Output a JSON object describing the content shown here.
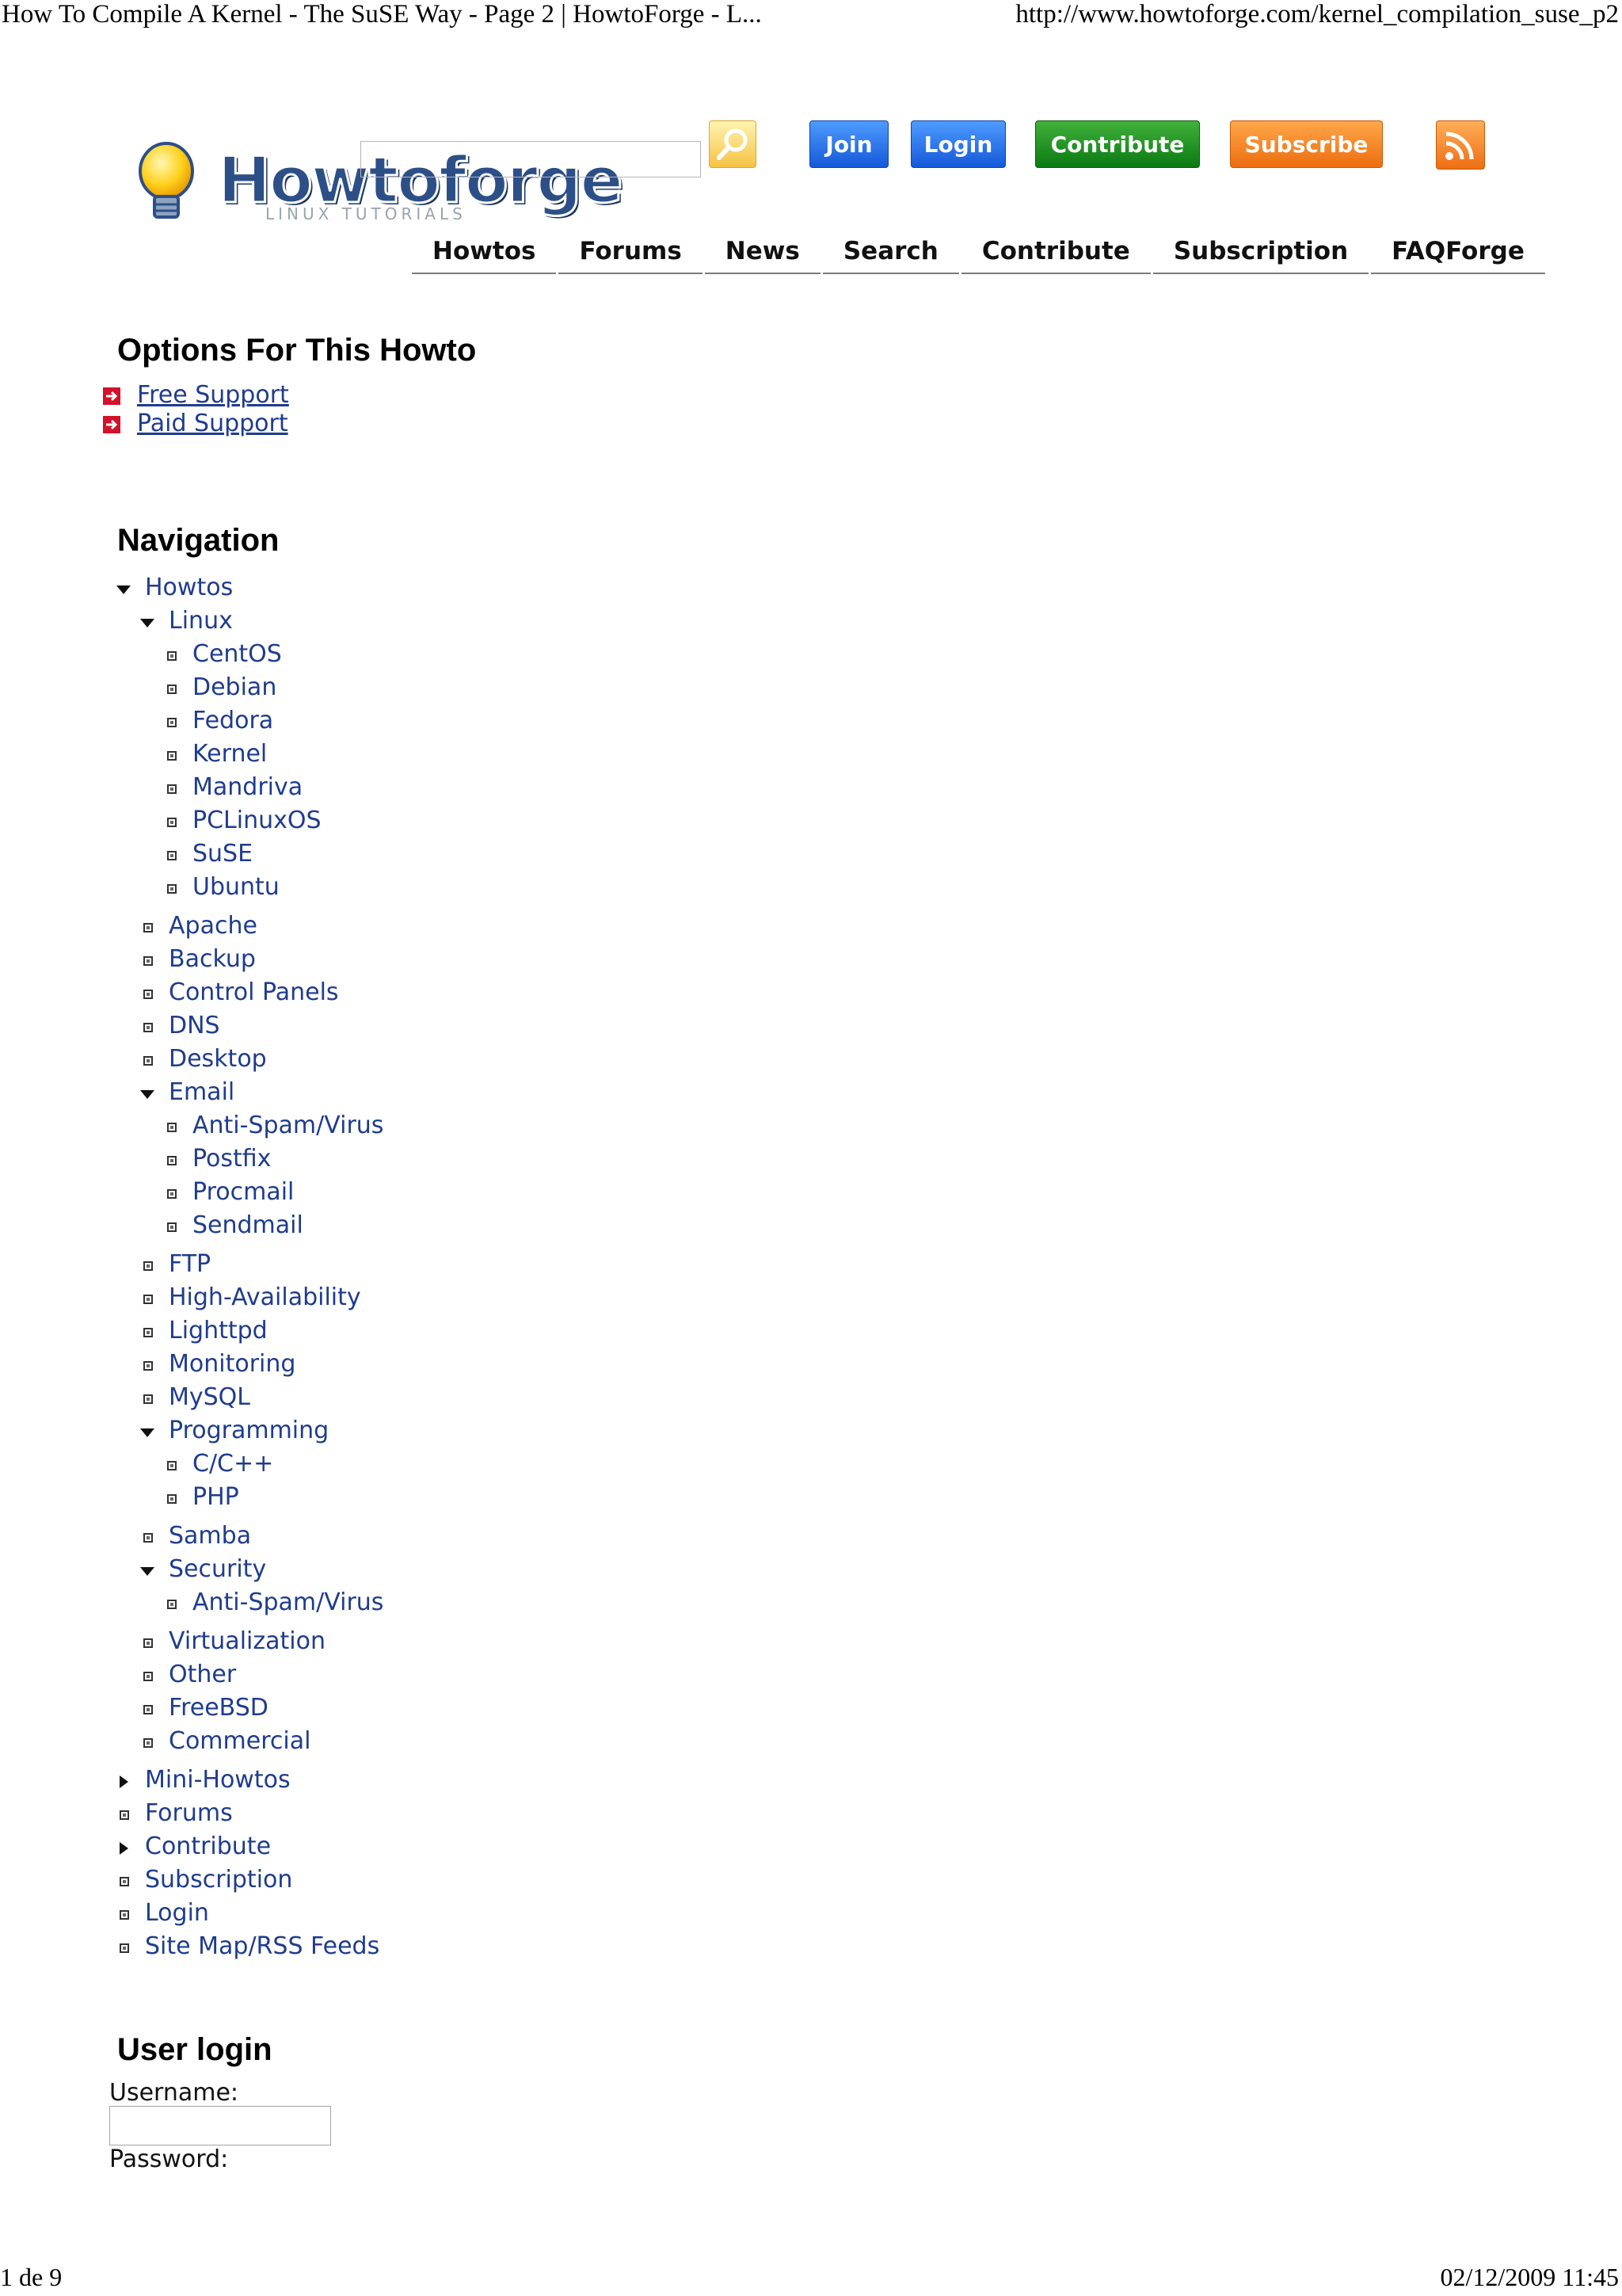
{
  "print": {
    "title": "How To Compile A Kernel - The SuSE Way - Page 2 | HowtoForge - L...",
    "url": "http://www.howtoforge.com/kernel_compilation_suse_p2",
    "page": "1 de 9",
    "datetime": "02/12/2009 11:45"
  },
  "header": {
    "logo_text": "Howtoforge",
    "logo_tagline": "LINUX TUTORIALS",
    "search": {
      "value": "",
      "placeholder": ""
    },
    "buttons": {
      "join": "Join",
      "login": "Login",
      "contribute": "Contribute",
      "subscribe": "Subscribe"
    }
  },
  "topnav": [
    "Howtos",
    "Forums",
    "News",
    "Search",
    "Contribute",
    "Subscription",
    "FAQForge"
  ],
  "options": {
    "title": "Options For This Howto",
    "links": [
      "Free Support",
      "Paid Support"
    ]
  },
  "navigation": {
    "title": "Navigation",
    "items": [
      {
        "label": "Howtos",
        "level": 0,
        "marker": "down"
      },
      {
        "label": "Linux",
        "level": 1,
        "marker": "down"
      },
      {
        "label": "CentOS",
        "level": 2,
        "marker": "bullet"
      },
      {
        "label": "Debian",
        "level": 2,
        "marker": "bullet"
      },
      {
        "label": "Fedora",
        "level": 2,
        "marker": "bullet"
      },
      {
        "label": "Kernel",
        "level": 2,
        "marker": "bullet"
      },
      {
        "label": "Mandriva",
        "level": 2,
        "marker": "bullet"
      },
      {
        "label": "PCLinuxOS",
        "level": 2,
        "marker": "bullet"
      },
      {
        "label": "SuSE",
        "level": 2,
        "marker": "bullet"
      },
      {
        "label": "Ubuntu",
        "level": 2,
        "marker": "bullet"
      },
      {
        "label": "Apache",
        "level": 1,
        "marker": "bullet",
        "gap": true
      },
      {
        "label": "Backup",
        "level": 1,
        "marker": "bullet"
      },
      {
        "label": "Control Panels",
        "level": 1,
        "marker": "bullet"
      },
      {
        "label": "DNS",
        "level": 1,
        "marker": "bullet"
      },
      {
        "label": "Desktop",
        "level": 1,
        "marker": "bullet"
      },
      {
        "label": "Email",
        "level": 1,
        "marker": "down"
      },
      {
        "label": "Anti-Spam/Virus",
        "level": 2,
        "marker": "bullet"
      },
      {
        "label": "Postfix",
        "level": 2,
        "marker": "bullet"
      },
      {
        "label": "Procmail",
        "level": 2,
        "marker": "bullet"
      },
      {
        "label": "Sendmail",
        "level": 2,
        "marker": "bullet"
      },
      {
        "label": "FTP",
        "level": 1,
        "marker": "bullet",
        "gap": true
      },
      {
        "label": "High-Availability",
        "level": 1,
        "marker": "bullet"
      },
      {
        "label": "Lighttpd",
        "level": 1,
        "marker": "bullet"
      },
      {
        "label": "Monitoring",
        "level": 1,
        "marker": "bullet"
      },
      {
        "label": "MySQL",
        "level": 1,
        "marker": "bullet"
      },
      {
        "label": "Programming",
        "level": 1,
        "marker": "down"
      },
      {
        "label": "C/C++",
        "level": 2,
        "marker": "bullet"
      },
      {
        "label": "PHP",
        "level": 2,
        "marker": "bullet"
      },
      {
        "label": "Samba",
        "level": 1,
        "marker": "bullet",
        "gap": true
      },
      {
        "label": "Security",
        "level": 1,
        "marker": "down"
      },
      {
        "label": "Anti-Spam/Virus",
        "level": 2,
        "marker": "bullet"
      },
      {
        "label": "Virtualization",
        "level": 1,
        "marker": "bullet",
        "gap": true
      },
      {
        "label": "Other",
        "level": 1,
        "marker": "bullet"
      },
      {
        "label": "FreeBSD",
        "level": 1,
        "marker": "bullet"
      },
      {
        "label": "Commercial",
        "level": 1,
        "marker": "bullet"
      },
      {
        "label": "Mini-Howtos",
        "level": 0,
        "marker": "right",
        "gap": true
      },
      {
        "label": "Forums",
        "level": 0,
        "marker": "bullet"
      },
      {
        "label": "Contribute",
        "level": 0,
        "marker": "right"
      },
      {
        "label": "Subscription",
        "level": 0,
        "marker": "bullet"
      },
      {
        "label": "Login",
        "level": 0,
        "marker": "bullet"
      },
      {
        "label": "Site Map/RSS Feeds",
        "level": 0,
        "marker": "bullet"
      }
    ]
  },
  "user_login": {
    "title": "User login",
    "username_label": "Username:",
    "username_value": "",
    "password_label": "Password:"
  },
  "colors": {
    "link": "#1f3c8e",
    "join": "#1559d8",
    "contribute": "#0b7a13",
    "subscribe": "#ec6e10"
  }
}
